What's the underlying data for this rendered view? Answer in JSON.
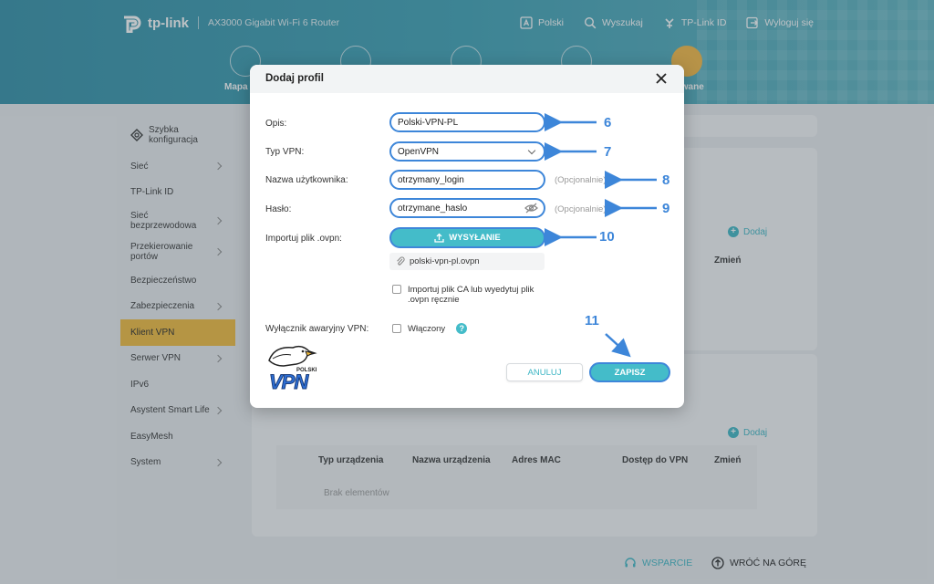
{
  "header": {
    "brand": "tp-link",
    "model": "AX3000 Gigabit Wi-Fi 6 Router",
    "nav": [
      {
        "label": "Polski",
        "icon": "language-icon"
      },
      {
        "label": "Wyszukaj",
        "icon": "search-icon"
      },
      {
        "label": "TP-Link ID",
        "icon": "tplink-id-icon"
      },
      {
        "label": "Wyloguj się",
        "icon": "logout-icon"
      }
    ],
    "modules": {
      "left_label": "Mapa",
      "right_label": "nsowane"
    }
  },
  "sidebar": {
    "quick": "Szybka konfiguracja",
    "items": [
      {
        "label": "Sieć",
        "chevron": true
      },
      {
        "label": "TP-Link ID",
        "chevron": false
      },
      {
        "label": "Sieć bezprzewodowa",
        "chevron": true
      },
      {
        "label": "Przekierowanie portów",
        "chevron": true
      },
      {
        "label": "Bezpieczeństwo",
        "chevron": false
      },
      {
        "label": "Zabezpieczenia",
        "chevron": true
      },
      {
        "label": "Klient VPN",
        "chevron": false,
        "active": true
      },
      {
        "label": "Serwer VPN",
        "chevron": true
      },
      {
        "label": "IPv6",
        "chevron": false
      },
      {
        "label": "Asystent Smart Life",
        "chevron": true
      },
      {
        "label": "EasyMesh",
        "chevron": false
      },
      {
        "label": "System",
        "chevron": true
      }
    ]
  },
  "main": {
    "add_label": "Dodaj",
    "table1": {
      "col_edit": "Zmień"
    },
    "table2": {
      "columns": [
        "Typ urządzenia",
        "Nazwa urządzenia",
        "Adres MAC",
        "Dostęp do VPN",
        "Zmień"
      ],
      "empty": "Brak elementów"
    }
  },
  "footer": {
    "support": "WSPARCIE",
    "back_to_top": "WRÓĆ NA GÓRĘ"
  },
  "modal": {
    "title": "Dodaj profil",
    "description_label": "Opis:",
    "description_value": "Polski-VPN-PL",
    "vpn_type_label": "Typ VPN:",
    "vpn_type_value": "OpenVPN",
    "username_label": "Nazwa użytkownika:",
    "username_value": "otrzymany_login",
    "password_label": "Hasło:",
    "password_value": "otrzymane_haslo",
    "optional": "(Opcjonalnie)",
    "import_label": "Importuj plik .ovpn:",
    "upload_button": "WYSYŁANIE",
    "file_name": "polski-vpn-pl.ovpn",
    "ca_checkbox": "Importuj plik CA lub wyedytuj plik .ovpn ręcznie",
    "killswitch_label": "Wyłącznik awaryjny VPN:",
    "killswitch_checkbox": "Włączony",
    "cancel": "ANULUJ",
    "save": "ZAPISZ",
    "logo_small": "POLSKI",
    "logo_big": "VPN"
  },
  "annotations": [
    "6",
    "7",
    "8",
    "9",
    "10",
    "11"
  ],
  "colors": {
    "header": "#3aa0b4",
    "accent": "#44bcc9",
    "highlight": "#3d86d9",
    "active_menu": "#f1bb3a"
  }
}
